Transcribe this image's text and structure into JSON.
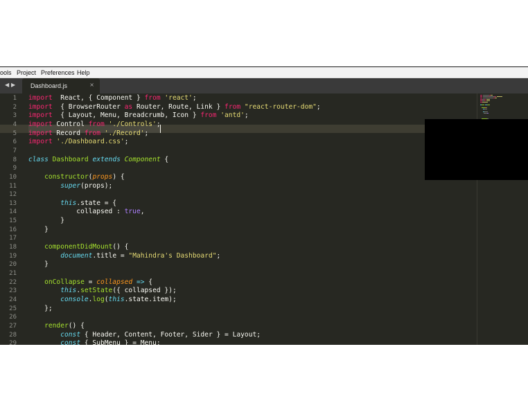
{
  "menubar": {
    "items": [
      "ools",
      "Project",
      "Preferences",
      "Help"
    ]
  },
  "tabbar": {
    "back_icon": "◀",
    "forward_icon": "▶",
    "tab_label": "Dashboard.js",
    "close_icon": "×"
  },
  "colors": {
    "background": "#272822",
    "keyword": "#f92672",
    "string": "#e6db74",
    "number_bool": "#ae81ff",
    "function": "#a6e22e",
    "storage_italic": "#66d9ef",
    "parameter": "#fd971f",
    "plain": "#f8f8f2",
    "gutter_text": "#8f908a"
  },
  "editor": {
    "line_numbers": [
      "1",
      "2",
      "3",
      "4",
      "5",
      "6",
      "7",
      "8",
      "9",
      "10",
      "11",
      "12",
      "13",
      "14",
      "15",
      "16",
      "17",
      "18",
      "19",
      "20",
      "21",
      "22",
      "23",
      "24",
      "25",
      "26",
      "27",
      "28",
      "29"
    ],
    "lines": [
      [
        [
          "k",
          "import"
        ],
        [
          "",
          "  React, { Component } "
        ],
        [
          "k",
          "from"
        ],
        [
          "",
          ""
        ],
        [
          "s",
          " 'react'"
        ],
        [
          "",
          ";"
        ]
      ],
      [
        [
          "k",
          "import"
        ],
        [
          "",
          "  { BrowserRouter "
        ],
        [
          "k",
          "as"
        ],
        [
          "",
          " Router, Route, Link } "
        ],
        [
          "k",
          "from"
        ],
        [
          "s",
          " \"react-router-dom\""
        ],
        [
          "",
          ";"
        ]
      ],
      [
        [
          "k",
          "import"
        ],
        [
          "",
          "  { Layout, Menu, Breadcrumb, Icon } "
        ],
        [
          "k",
          "from"
        ],
        [
          "s",
          " 'antd'"
        ],
        [
          "",
          ";"
        ]
      ],
      [
        [
          "k",
          "import"
        ],
        [
          "",
          " Control "
        ],
        [
          "k",
          "from"
        ],
        [
          "s",
          " './Controls'"
        ],
        [
          "",
          ";"
        ]
      ],
      [
        [
          "k",
          "import"
        ],
        [
          "",
          " Record "
        ],
        [
          "k",
          "from"
        ],
        [
          "s",
          " './Record'"
        ],
        [
          "",
          ";"
        ]
      ],
      [
        [
          "k",
          "import"
        ],
        [
          "s",
          " './Dashboard.css'"
        ],
        [
          "",
          ";"
        ]
      ],
      [],
      [
        [
          "i",
          "class"
        ],
        [
          "",
          " "
        ],
        [
          "f",
          "Dashboard"
        ],
        [
          "",
          " "
        ],
        [
          "i",
          "extends"
        ],
        [
          "",
          " "
        ],
        [
          "g",
          "Component"
        ],
        [
          "",
          " {"
        ]
      ],
      [],
      [
        [
          "",
          "    "
        ],
        [
          "f",
          "constructor"
        ],
        [
          "",
          "("
        ],
        [
          "p",
          "props"
        ],
        [
          "",
          ") {"
        ]
      ],
      [
        [
          "",
          "        "
        ],
        [
          "i",
          "super"
        ],
        [
          "",
          "(props);"
        ]
      ],
      [],
      [
        [
          "",
          "        "
        ],
        [
          "i",
          "this"
        ],
        [
          "",
          ".state = {"
        ]
      ],
      [
        [
          "",
          "            collapsed : "
        ],
        [
          "n",
          "true"
        ],
        [
          "",
          ","
        ]
      ],
      [
        [
          "",
          "        }"
        ]
      ],
      [
        [
          "",
          "    }"
        ]
      ],
      [],
      [
        [
          "",
          "    "
        ],
        [
          "f",
          "componentDidMount"
        ],
        [
          "",
          "() {"
        ]
      ],
      [
        [
          "",
          "        "
        ],
        [
          "i",
          "document"
        ],
        [
          "",
          ".title = "
        ],
        [
          "s",
          "\"Mahindra's Dashboard\""
        ],
        [
          "",
          ";"
        ]
      ],
      [
        [
          "",
          "    }"
        ]
      ],
      [],
      [
        [
          "",
          "    "
        ],
        [
          "f",
          "onCollapse"
        ],
        [
          "",
          " = "
        ],
        [
          "p",
          "collapsed"
        ],
        [
          "",
          " "
        ],
        [
          "ic",
          "=>"
        ],
        [
          "",
          " {"
        ]
      ],
      [
        [
          "",
          "        "
        ],
        [
          "i",
          "this"
        ],
        [
          "",
          "."
        ],
        [
          "f",
          "setState"
        ],
        [
          "",
          "({ collapsed });"
        ]
      ],
      [
        [
          "",
          "        "
        ],
        [
          "i",
          "console"
        ],
        [
          "",
          "."
        ],
        [
          "f",
          "log"
        ],
        [
          "",
          "("
        ],
        [
          "i",
          "this"
        ],
        [
          "",
          ".state.item);"
        ]
      ],
      [
        [
          "",
          "    };"
        ]
      ],
      [],
      [
        [
          "",
          "    "
        ],
        [
          "f",
          "render"
        ],
        [
          "",
          "() {"
        ]
      ],
      [
        [
          "",
          "        "
        ],
        [
          "i",
          "const"
        ],
        [
          "",
          " { Header, Content, Footer, Sider } = Layout;"
        ]
      ],
      [
        [
          "",
          "        "
        ],
        [
          "i",
          "const"
        ],
        [
          "",
          " { SubMenu } = Menu;"
        ]
      ]
    ]
  }
}
